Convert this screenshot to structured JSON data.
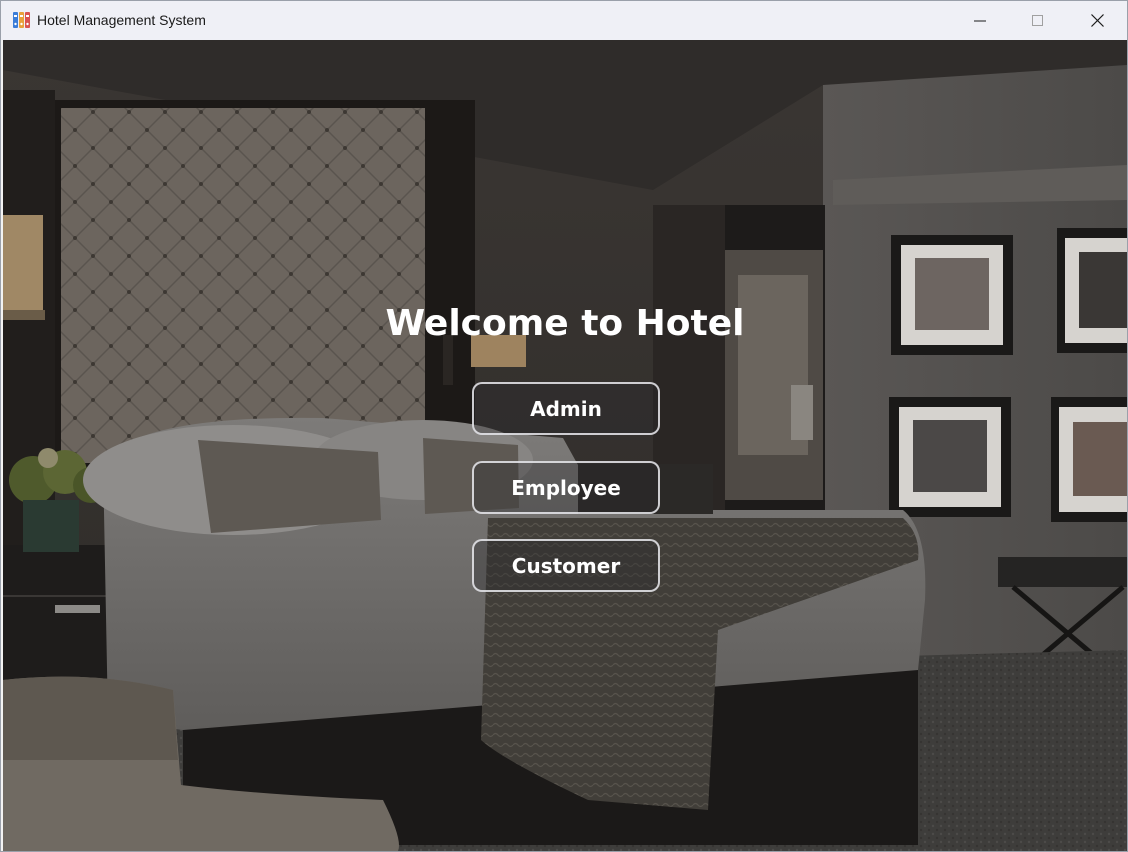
{
  "window": {
    "title": "Hotel Management System",
    "icon": "app-books-icon",
    "controls": [
      "minimize-icon",
      "maximize-icon",
      "close-icon"
    ]
  },
  "main": {
    "heading": "Welcome to Hotel",
    "buttons": {
      "admin": "Admin",
      "employee": "Employee",
      "customer": "Customer"
    }
  },
  "colors": {
    "titlebar": "#eff0f6",
    "heading": "#ffffff",
    "button_border": "#ebebf0"
  }
}
